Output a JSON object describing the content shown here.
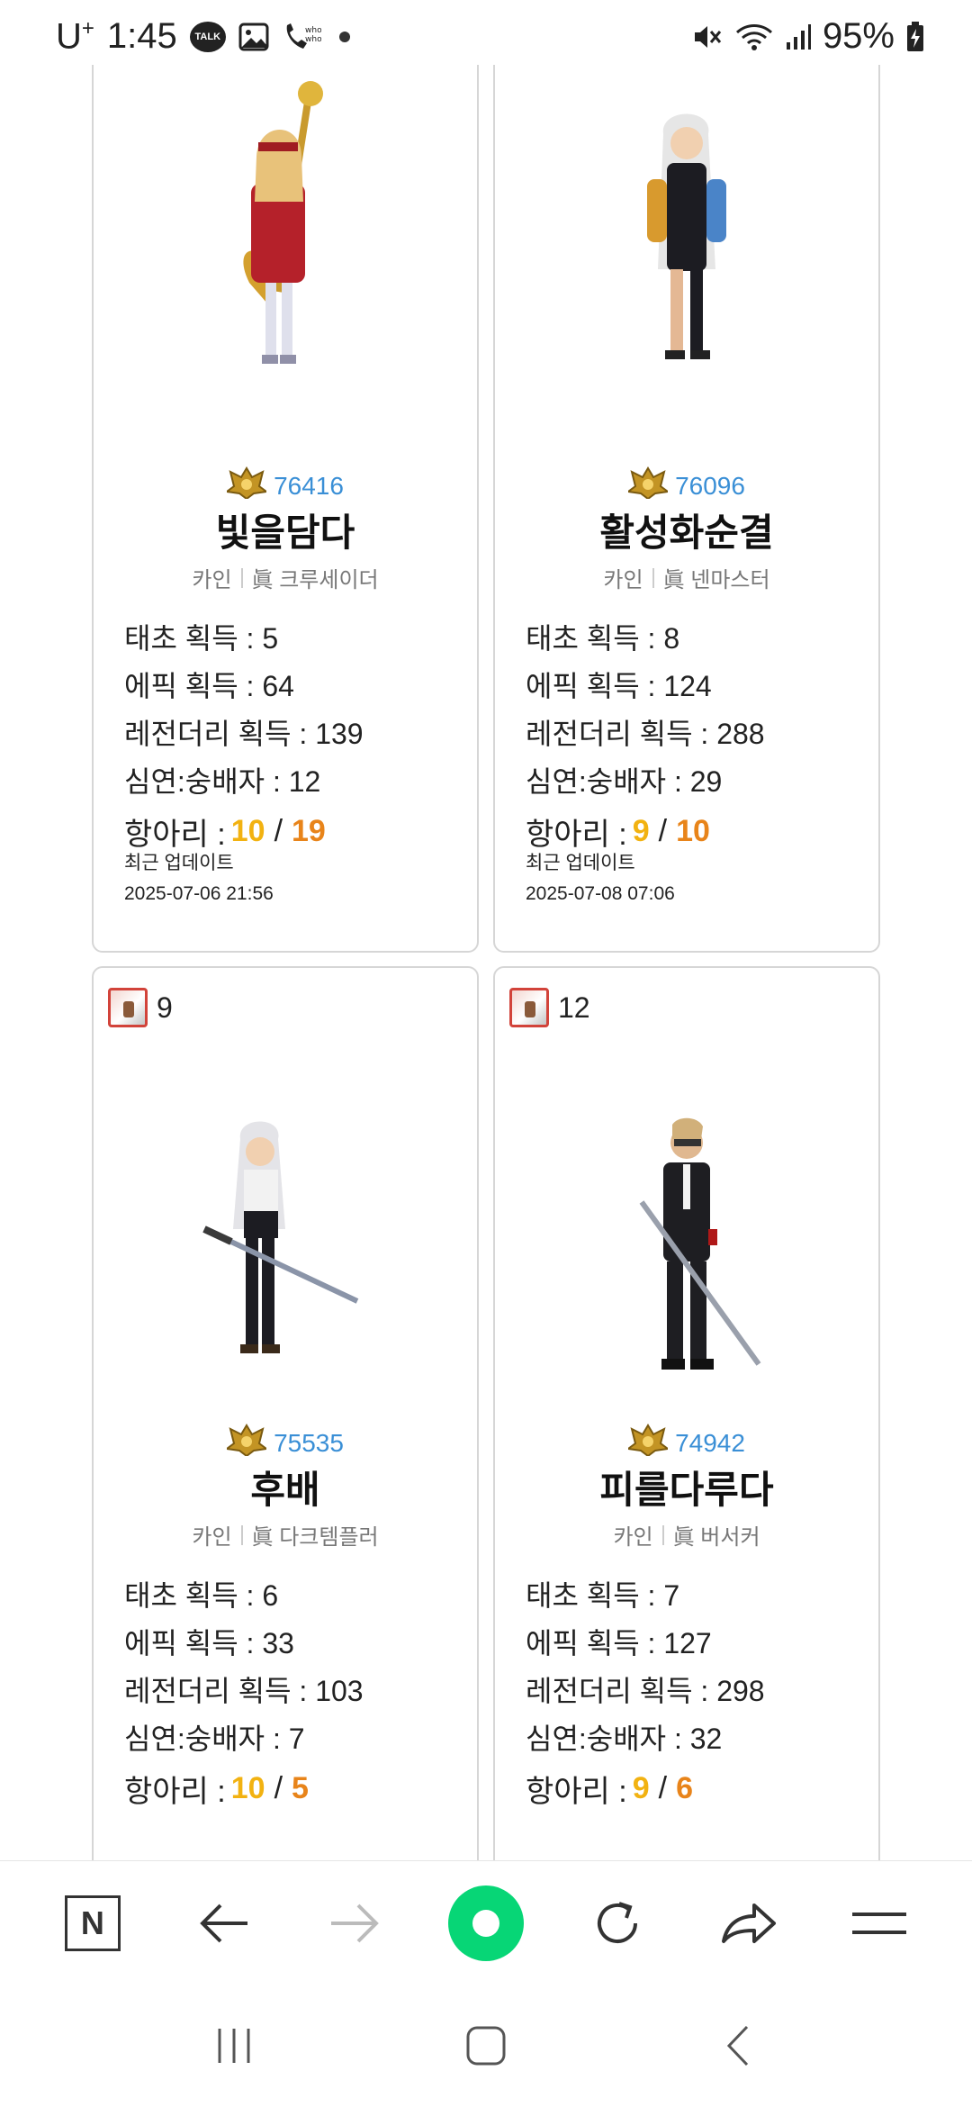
{
  "status_bar": {
    "carrier": "U",
    "carrier_sup": "+",
    "time": "1:45",
    "talk_label": "TALK",
    "battery": "95%"
  },
  "cards": [
    {
      "fame": "76416",
      "name": "빛을담다",
      "server": "카인",
      "job": "眞 크루세이더",
      "stats": [
        "태초 획득 : 5",
        "에픽 획득 : 64",
        "레전더리 획득 : 139",
        "심연:숭배자 : 12"
      ],
      "ring_label": "항아리 :",
      "ring_a": "10",
      "ring_b": "19",
      "update_label": "최근 업데이트",
      "update_time": "2025-07-06 21:56"
    },
    {
      "fame": "76096",
      "name": "활성화순결",
      "server": "카인",
      "job": "眞 넨마스터",
      "stats": [
        "태초 획득 : 8",
        "에픽 획득 : 124",
        "레전더리 획득 : 288",
        "심연:숭배자 : 29"
      ],
      "ring_label": "항아리 :",
      "ring_a": "9",
      "ring_b": "10",
      "update_label": "최근 업데이트",
      "update_time": "2025-07-08 07:06"
    },
    {
      "favorite_count": "9",
      "fame": "75535",
      "name": "후배",
      "server": "카인",
      "job": "眞 다크템플러",
      "stats": [
        "태초 획득 : 6",
        "에픽 획득 : 33",
        "레전더리 획득 : 103",
        "심연:숭배자 : 7"
      ],
      "ring_label": "항아리 :",
      "ring_a": "10",
      "ring_b": "5"
    },
    {
      "favorite_count": "12",
      "fame": "74942",
      "name": "피를다루다",
      "server": "카인",
      "job": "眞 버서커",
      "stats": [
        "태초 획득 : 7",
        "에픽 획득 : 127",
        "레전더리 획득 : 298",
        "심연:숭배자 : 32"
      ],
      "ring_label": "항아리 :",
      "ring_a": "9",
      "ring_b": "6"
    }
  ],
  "toolbar": {
    "home_letter": "N",
    "icons": [
      "naver-home-icon",
      "back-arrow-icon",
      "forward-arrow-icon",
      "green-dot-icon",
      "refresh-icon",
      "share-icon",
      "menu-icon"
    ]
  },
  "colors": {
    "fame_blue": "#3a8fd6",
    "ring_yellow": "#f2b211",
    "ring_orange": "#e8841a",
    "accent_green": "#07d676",
    "card_border": "#d6d6d6"
  }
}
